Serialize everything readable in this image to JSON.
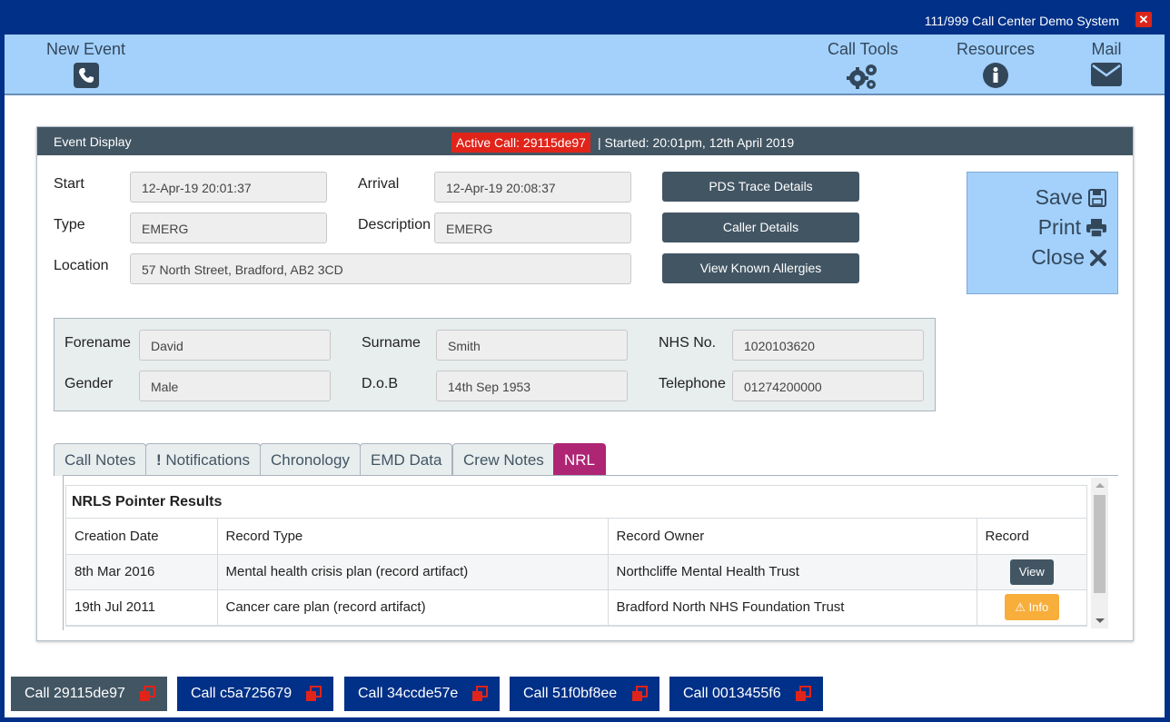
{
  "app": {
    "title": "111/999 Call Center Demo System"
  },
  "toolbar": {
    "new_event": "New Event",
    "call_tools": "Call Tools",
    "resources": "Resources",
    "mail": "Mail"
  },
  "event": {
    "panel_title": "Event Display",
    "active_call": "Active Call: 29115de97",
    "started": "| Started: 20:01pm, 12th April 2019",
    "start_label": "Start",
    "start_value": "12-Apr-19 20:01:37",
    "arrival_label": "Arrival",
    "arrival_value": "12-Apr-19 20:08:37",
    "type_label": "Type",
    "type_value": "EMERG",
    "description_label": "Description",
    "description_value": "EMERG",
    "location_label": "Location",
    "location_value": "57 North Street, Bradford, AB2 3CD"
  },
  "buttons": {
    "pds": "PDS Trace Details",
    "caller": "Caller Details",
    "allergies": "View Known Allergies"
  },
  "actions": {
    "save": "Save",
    "print": "Print",
    "close": "Close"
  },
  "patient": {
    "forename_label": "Forename",
    "forename_value": "David",
    "surname_label": "Surname",
    "surname_value": "Smith",
    "nhs_label": "NHS No.",
    "nhs_value": "1020103620",
    "gender_label": "Gender",
    "gender_value": "Male",
    "dob_label": "D.o.B",
    "dob_value": "14th Sep 1953",
    "telephone_label": "Telephone",
    "telephone_value": "01274200000"
  },
  "tabs": [
    {
      "label": "Call Notes"
    },
    {
      "label": "Notifications"
    },
    {
      "label": "Chronology"
    },
    {
      "label": "EMD Data"
    },
    {
      "label": "Crew Notes"
    },
    {
      "label": "NRL"
    }
  ],
  "results": {
    "title": "NRLS Pointer Results",
    "columns": [
      "Creation Date",
      "Record Type",
      "Record Owner",
      "Record"
    ],
    "rows": [
      {
        "date": "8th Mar 2016",
        "type": "Mental health crisis plan (record artifact)",
        "owner": "Northcliffe Mental Health Trust",
        "action": "View"
      },
      {
        "date": "19th Jul 2011",
        "type": "Cancer care plan (record artifact)",
        "owner": "Bradford North NHS Foundation Trust",
        "action": "Info"
      }
    ]
  },
  "calls": [
    {
      "label": "Call 29115de97"
    },
    {
      "label": "Call c5a725679"
    },
    {
      "label": "Call 34ccde57e"
    },
    {
      "label": "Call 51f0bf8ee"
    },
    {
      "label": "Call 0013455f6"
    }
  ],
  "colors": {
    "nhs_blue": "#003087",
    "light_blue": "#a3d1fc",
    "dark_slate": "#425563",
    "active_red": "#e0241a",
    "nrl_tab": "#ae2573",
    "info_orange": "#f7ae3a"
  }
}
